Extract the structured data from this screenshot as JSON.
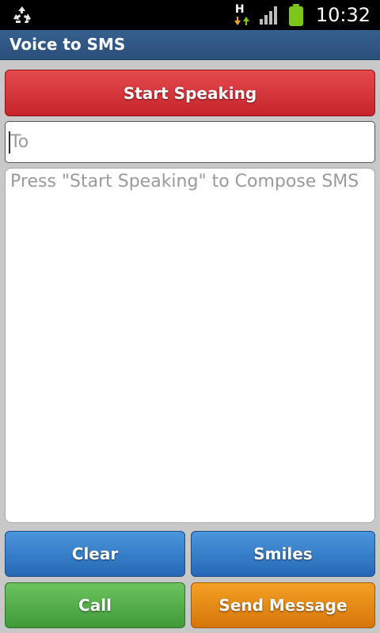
{
  "status_bar": {
    "time": "10:32",
    "network_label": "H",
    "icons": [
      "recycle-icon",
      "network-h-icon",
      "signal-icon",
      "battery-icon"
    ]
  },
  "app": {
    "title": "Voice to SMS"
  },
  "buttons": {
    "start_speaking": "Start Speaking",
    "clear": "Clear",
    "smiles": "Smiles",
    "call": "Call",
    "send_message": "Send Message"
  },
  "fields": {
    "to": {
      "placeholder": "To",
      "value": ""
    },
    "message": {
      "placeholder": "Press \"Start Speaking\" to Compose SMS",
      "value": ""
    }
  },
  "colors": {
    "title_bar": "#2a4f7b",
    "start_button": "#d2363a",
    "clear_button": "#3a7fcf",
    "smiles_button": "#3a7fcf",
    "call_button": "#54ad48",
    "send_button": "#e48512",
    "battery": "#7cc61c"
  }
}
